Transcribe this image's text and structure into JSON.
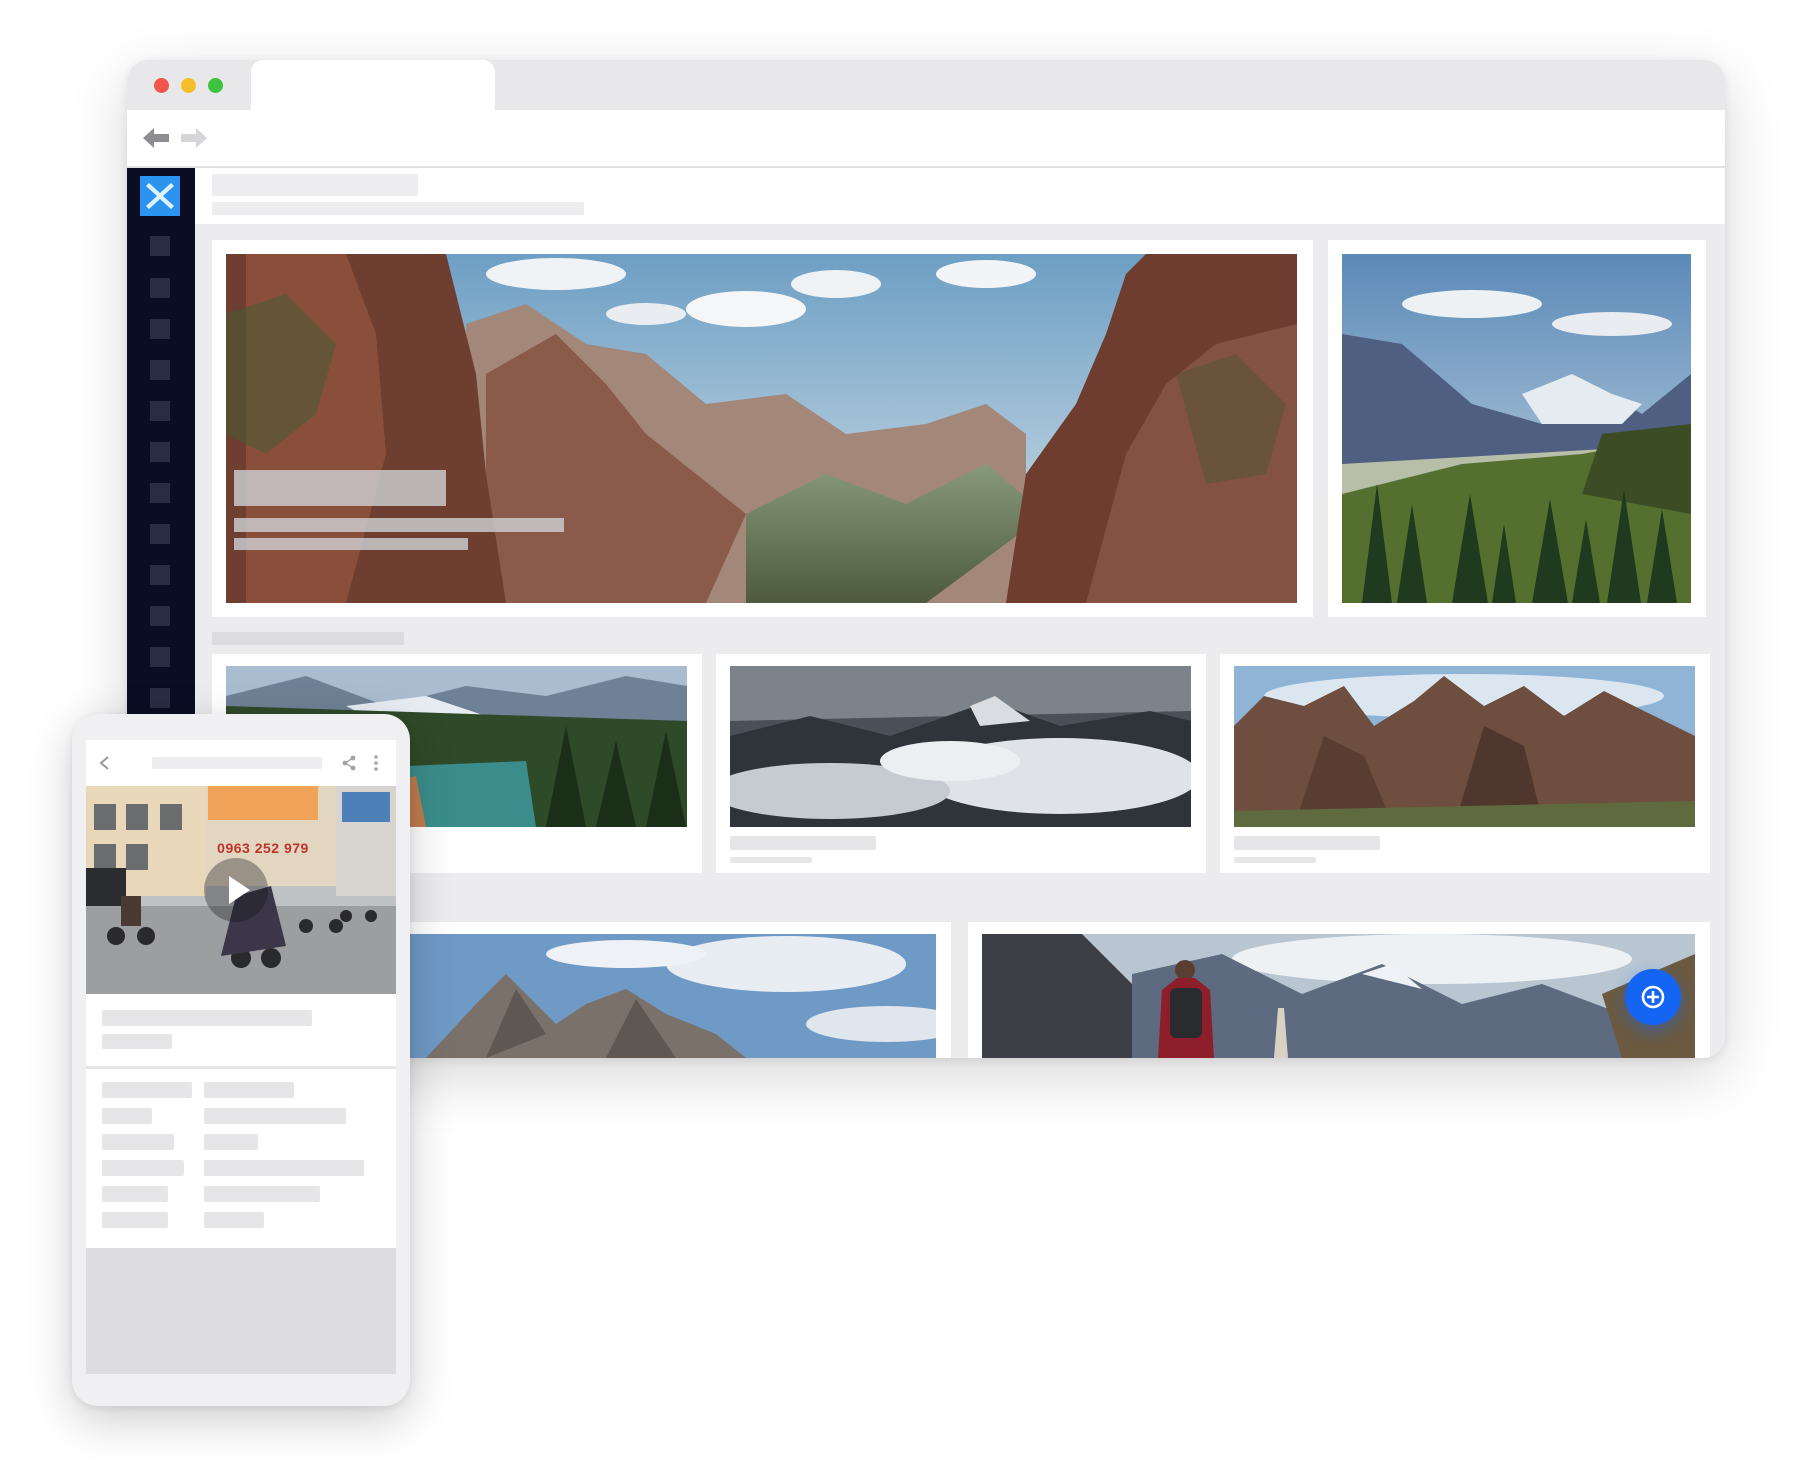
{
  "browser": {
    "traffic_lights": [
      "#f2554d",
      "#f6bd2a",
      "#3cc440"
    ],
    "nav_icons": [
      "back-arrow-icon",
      "forward-arrow-icon"
    ],
    "accent": "#2d93f0",
    "sidebar_bg": "#0b0d24",
    "sidebar_item_count": 12,
    "fab": {
      "icon": "plus-circle-icon",
      "color": "#1565f5"
    }
  },
  "gallery": {
    "featured": [
      {
        "subject": "red-rock-canyon-valley"
      },
      {
        "subject": "alpine-valley-with-pines"
      }
    ],
    "row2": [
      {
        "subject": "forest-lake-mountains"
      },
      {
        "subject": "cloudy-snow-peaks"
      },
      {
        "subject": "rocky-pinnacles"
      }
    ],
    "row3": [
      {
        "subject": "granite-peaks-clouds"
      },
      {
        "subject": "hiker-himalaya"
      }
    ]
  },
  "mobile": {
    "appbar_icons": [
      "chevron-left-icon",
      "share-icon",
      "more-vert-icon"
    ],
    "video": {
      "sign_text": "0963 252 979",
      "play_icon": "play-icon"
    },
    "detail_rows": 6
  }
}
